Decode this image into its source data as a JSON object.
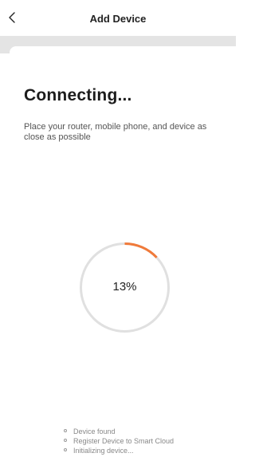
{
  "header": {
    "title": "Add Device",
    "back_icon": "chevron-left-icon"
  },
  "main": {
    "heading": "Connecting...",
    "description": "Place your router, mobile phone, and device as close as possible",
    "progress": {
      "percent_label": "13%",
      "value": 0.13,
      "track_color": "#e0e0e0",
      "fill_color": "#f07a3a"
    },
    "steps": [
      {
        "label": "Device found"
      },
      {
        "label": "Register Device to Smart Cloud"
      },
      {
        "label": "Initializing device..."
      }
    ]
  },
  "colors": {
    "background": "#ffffff",
    "band": "#e4e4e4",
    "accent": "#f07a3a"
  }
}
